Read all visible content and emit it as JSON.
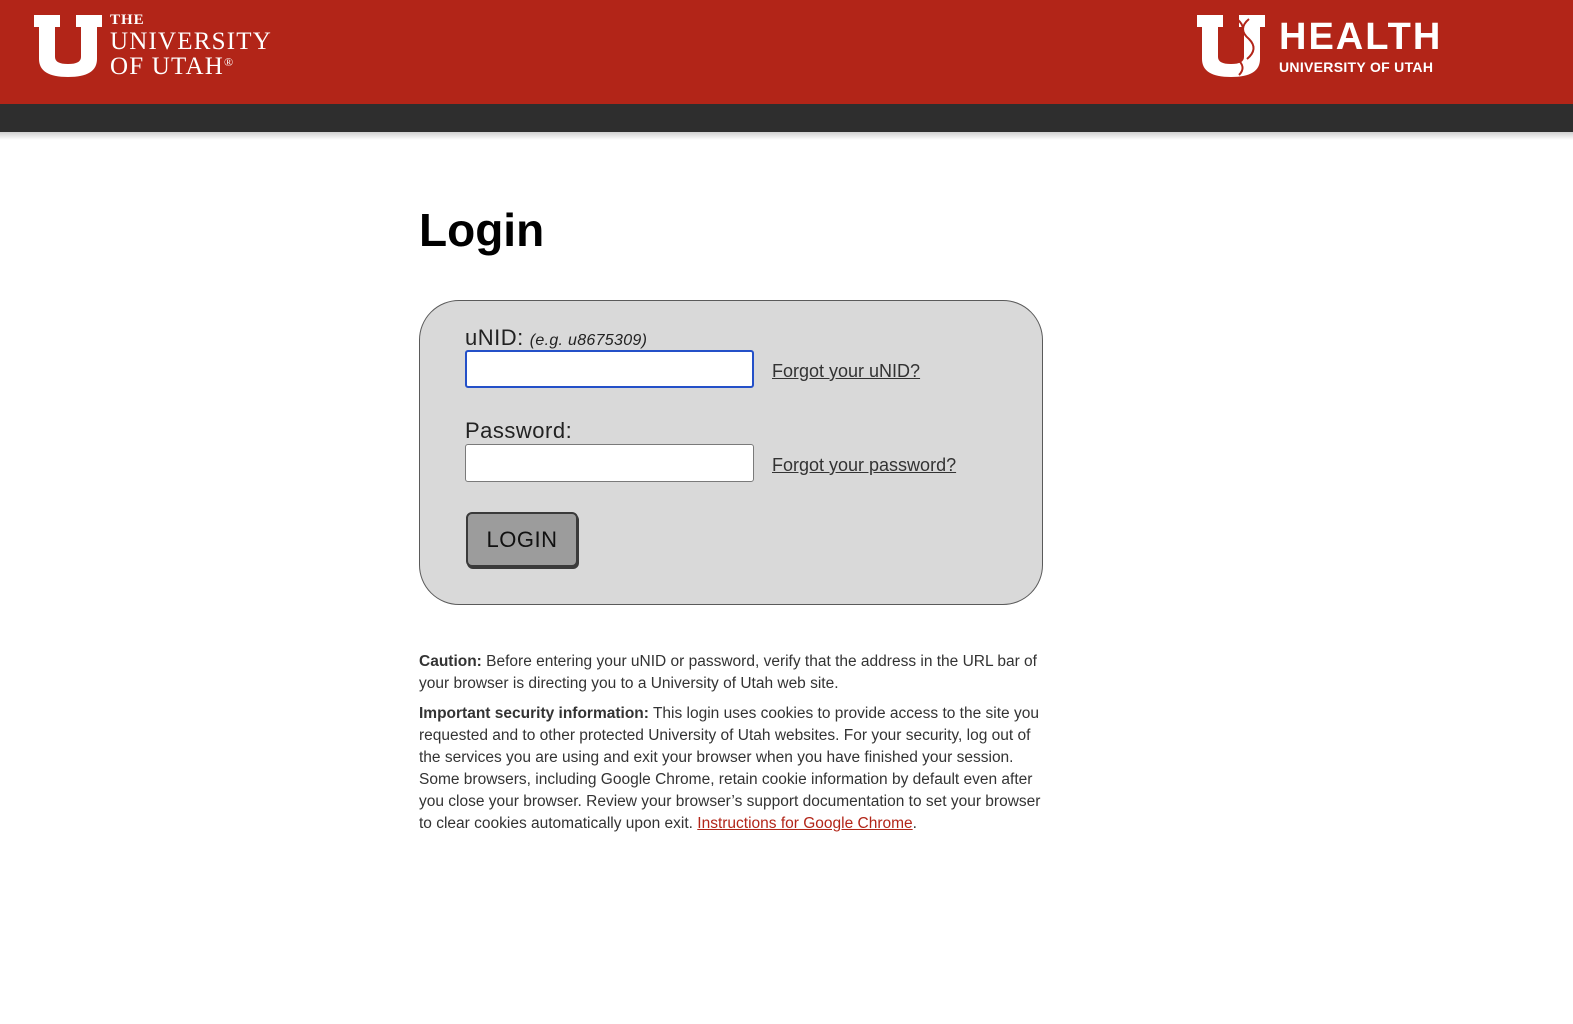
{
  "header": {
    "university_logo": {
      "the": "THE",
      "university": "UNIVERSITY",
      "of_utah": "OF UTAH",
      "registered": "®"
    },
    "health_logo": {
      "health": "HEALTH",
      "subtitle": "UNIVERSITY OF UTAH"
    },
    "brand_color": "#b22518",
    "nav_color": "#2e2e2e"
  },
  "page": {
    "title": "Login"
  },
  "form": {
    "unid_label": "uNID:",
    "unid_hint": "(e.g. u8675309)",
    "unid_value": "",
    "forgot_unid": "Forgot your uNID?",
    "password_label": "Password:",
    "password_value": "",
    "forgot_password": "Forgot your password?",
    "login_button": "LOGIN"
  },
  "notices": {
    "caution_label": "Caution:",
    "caution_text": " Before entering your uNID or password, verify that the address in the URL bar of your browser is directing you to a University of Utah web site.",
    "security_label": "Important security information:",
    "security_text": " This login uses cookies to provide access to the site you requested and to other protected University of Utah websites. For your security, log out of the services you are using and exit your browser when you have finished your session. Some browsers, including Google Chrome, retain cookie information by default even after you close your browser. Review your browser’s support documentation to set your browser to clear cookies automatically upon exit. ",
    "chrome_link": "Instructions for Google Chrome",
    "trailing_period": "."
  },
  "icons": {
    "university_u": "block-u-icon",
    "health_u": "block-u-dna-icon"
  }
}
